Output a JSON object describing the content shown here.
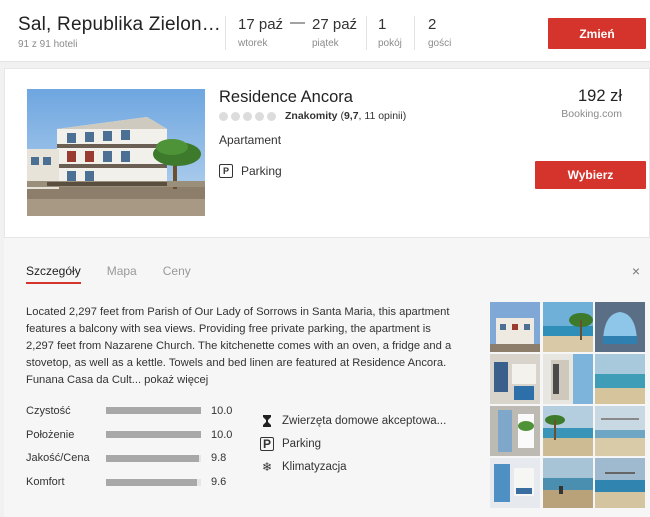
{
  "search": {
    "destination": "Sal, Republika Zielon…",
    "hotel_count": "91 z 91 hoteli",
    "checkin_date": "17 paź",
    "checkin_day": "wtorek",
    "dash": "—",
    "checkout_date": "27 paź",
    "checkout_day": "piątek",
    "rooms_value": "1",
    "rooms_label": "pokój",
    "guests_value": "2",
    "guests_label": "gości",
    "change_button": "Zmień"
  },
  "hotel": {
    "name": "Residence Ancora",
    "rating_word": "Znakomity",
    "rating_score": "9,7",
    "rating_reviews": ", 11 opinii)",
    "rating_open": "(",
    "type": "Apartament",
    "amenity_icon_letter": "P",
    "amenity": "Parking",
    "price": "192 zł",
    "provider": "Booking.com",
    "select_button": "Wybierz",
    "photo_icon": "hotel-photo"
  },
  "details": {
    "tabs": [
      "Szczegóły",
      "Mapa",
      "Ceny"
    ],
    "active_tab": 0,
    "close_symbol": "×",
    "description": "Located 2,297 feet from Parish of Our Lady of Sorrows in Santa Maria, this apartment features a balcony with sea views. Providing free private parking, the apartment is 2,297 feet from Nazarene Church. The kitchenette comes with an oven, a fridge and a stovetop, as well as a kettle. Towels and bed linen are featured at Residence Ancora. Funana Casa da Cult...",
    "show_more": "pokaż więcej",
    "scores": [
      {
        "label": "Czystość",
        "value": "10.0",
        "fraction": 1.0
      },
      {
        "label": "Położenie",
        "value": "10.0",
        "fraction": 1.0
      },
      {
        "label": "Jakość/Cena",
        "value": "9.8",
        "fraction": 0.98
      },
      {
        "label": "Komfort",
        "value": "9.6",
        "fraction": 0.96
      }
    ],
    "facilities": [
      {
        "icon": "pet-icon",
        "label": "Zwierzęta domowe akceptowa..."
      },
      {
        "icon": "parking-icon",
        "label": "Parking"
      },
      {
        "icon": "snowflake-icon",
        "label": "Klimatyzacja"
      }
    ],
    "parking_letter": "P",
    "snowflake_glyph": "❄",
    "pet_glyph": "⧗"
  },
  "colors": {
    "accent": "#d4342b"
  }
}
